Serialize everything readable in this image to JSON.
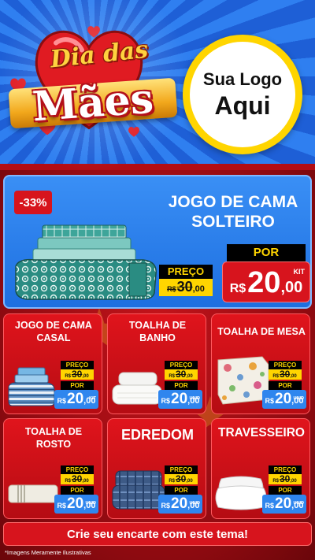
{
  "header": {
    "title_line1": "Dia das",
    "title_line2": "Mães",
    "logo_line1": "Sua Logo",
    "logo_line2": "Aqui"
  },
  "featured": {
    "discount": "-33%",
    "title_line1": "JOGO DE CAMA",
    "title_line2": "SOLTEIRO",
    "preco_label": "PREÇO",
    "old_currency": "R$",
    "old_value": "30",
    "old_cents": ",00",
    "por_label": "POR",
    "new_currency": "R$",
    "new_value": "20",
    "new_cents": ",00",
    "unit": "KIT"
  },
  "cards": [
    {
      "title_line1": "JOGO DE CAMA",
      "title_line2": "CASAL",
      "preco_label": "PREÇO",
      "old_currency": "R$",
      "old_value": "30",
      "old_cents": ",00",
      "por_label": "POR",
      "new_currency": "R$",
      "new_value": "20",
      "new_cents": ",00",
      "unit": "KIT"
    },
    {
      "title_line1": "TOALHA DE",
      "title_line2": "BANHO",
      "preco_label": "PREÇO",
      "old_currency": "R$",
      "old_value": "30",
      "old_cents": ",00",
      "por_label": "POR",
      "new_currency": "R$",
      "new_value": "20",
      "new_cents": ",00",
      "unit": "UNID"
    },
    {
      "title_line1": "TOALHA DE MESA",
      "title_line2": "",
      "preco_label": "PREÇO",
      "old_currency": "R$",
      "old_value": "30",
      "old_cents": ",00",
      "por_label": "POR",
      "new_currency": "R$",
      "new_value": "20",
      "new_cents": ",00",
      "unit": "UNID"
    },
    {
      "title_line1": "TOALHA DE",
      "title_line2": "ROSTO",
      "preco_label": "PREÇO",
      "old_currency": "R$",
      "old_value": "30",
      "old_cents": ",00",
      "por_label": "POR",
      "new_currency": "R$",
      "new_value": "20",
      "new_cents": ",00",
      "unit": "UNID"
    },
    {
      "title_line1": "EDREDOM",
      "title_line2": "",
      "preco_label": "PREÇO",
      "old_currency": "R$",
      "old_value": "30",
      "old_cents": ",00",
      "por_label": "POR",
      "new_currency": "R$",
      "new_value": "20",
      "new_cents": ",00",
      "unit": "UNID"
    },
    {
      "title_line1": "TRAVESSEIRO",
      "title_line2": "",
      "preco_label": "PREÇO",
      "old_currency": "R$",
      "old_value": "30",
      "old_cents": ",00",
      "por_label": "POR",
      "new_currency": "R$",
      "new_value": "20",
      "new_cents": ",00",
      "unit": "UNID"
    }
  ],
  "cta": "Crie seu encarte com este tema!",
  "footnote": "*Imagens Meramente Ilustrativas",
  "colors": {
    "header_blue": "#1e5fd6",
    "main_red": "#c4141b",
    "price_yellow": "#ffd500",
    "price_blue": "#2f86ee"
  }
}
